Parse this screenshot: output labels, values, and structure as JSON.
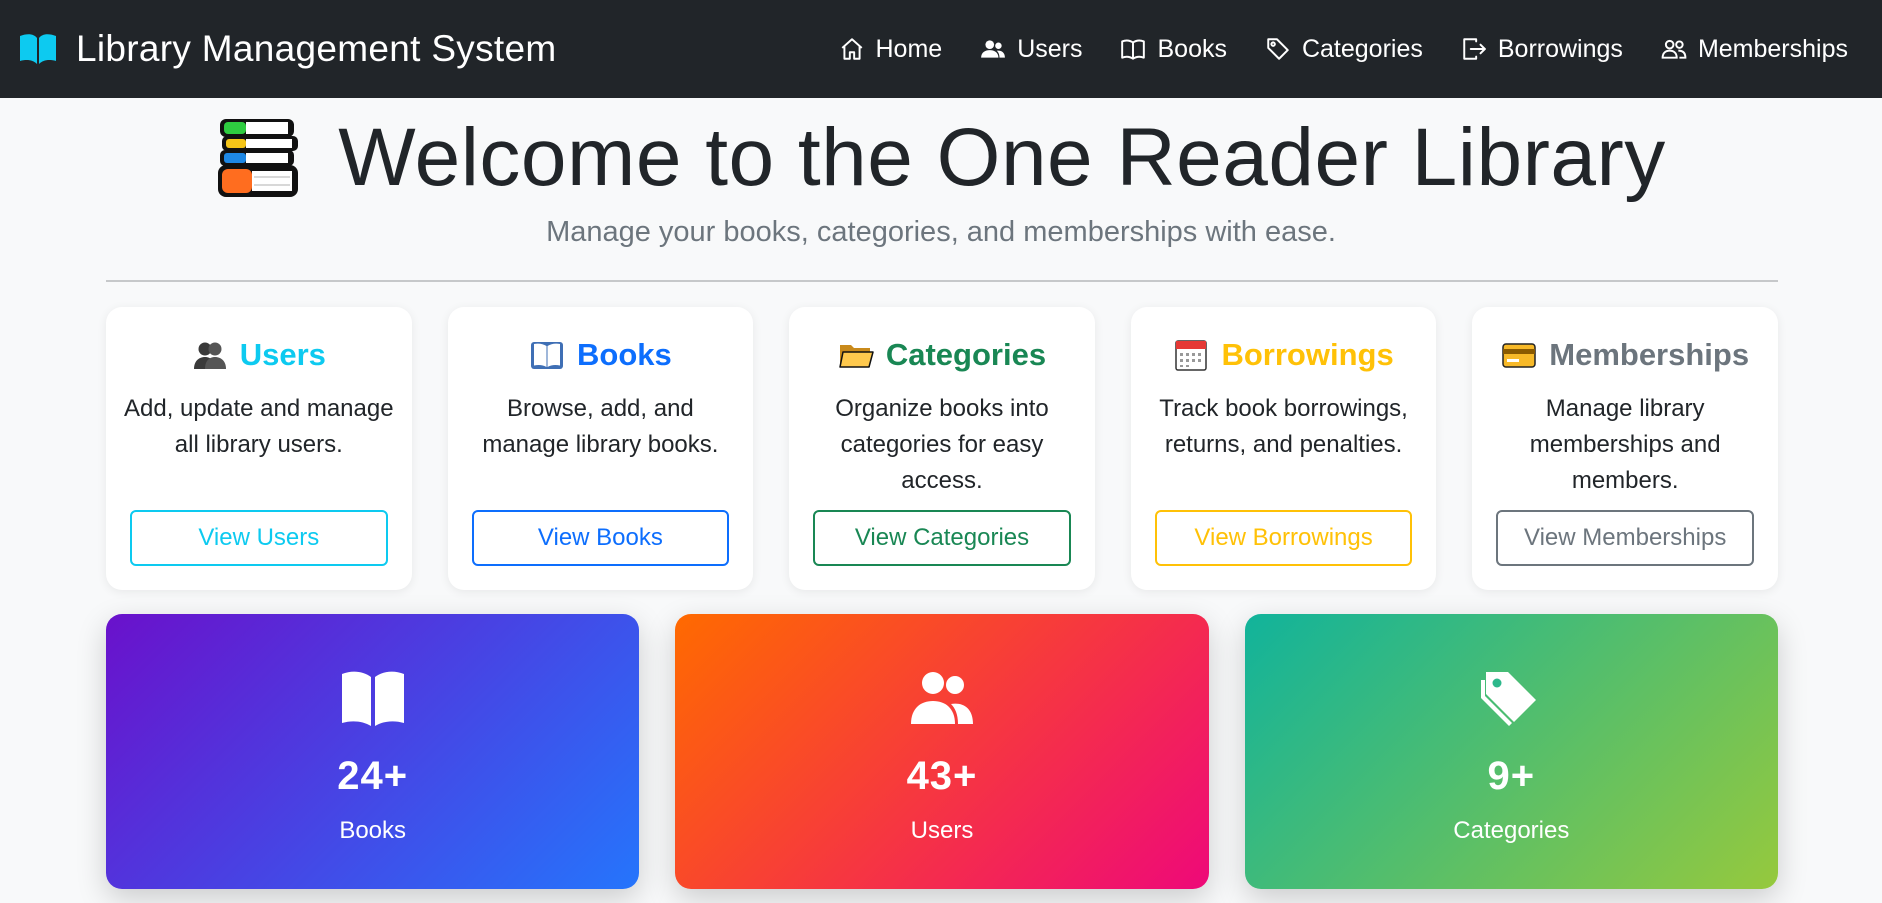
{
  "navbar": {
    "brand": "Library Management System",
    "items": [
      {
        "label": "Home",
        "icon": "house-icon"
      },
      {
        "label": "Users",
        "icon": "users-icon"
      },
      {
        "label": "Books",
        "icon": "book-icon"
      },
      {
        "label": "Categories",
        "icon": "tags-icon"
      },
      {
        "label": "Borrowings",
        "icon": "box-arrow-right-icon"
      },
      {
        "label": "Memberships",
        "icon": "people-icon"
      }
    ]
  },
  "hero": {
    "title": "Welcome to the One Reader Library",
    "subtitle": "Manage your books, categories, and memberships with ease.",
    "icon": "books-stack-icon"
  },
  "cards": [
    {
      "title": "Users",
      "description": "Add, update and manage all library users.",
      "button": "View Users",
      "icon": "users-emoji-icon",
      "color": "#0dcaf0"
    },
    {
      "title": "Books",
      "description": "Browse, add, and manage library books.",
      "button": "View Books",
      "icon": "open-book-emoji-icon",
      "color": "#0d6efd"
    },
    {
      "title": "Categories",
      "description": "Organize books into categories for easy access.",
      "button": "View Categories",
      "icon": "folder-emoji-icon",
      "color": "#198754"
    },
    {
      "title": "Borrowings",
      "description": "Track book borrowings, returns, and penalties.",
      "button": "View Borrowings",
      "icon": "calendar-emoji-icon",
      "color": "#ffc107"
    },
    {
      "title": "Memberships",
      "description": "Manage library memberships and members.",
      "button": "View Memberships",
      "icon": "credit-card-emoji-icon",
      "color": "#6c757d"
    }
  ],
  "stats": [
    {
      "value": "24+",
      "label": "Books",
      "icon": "book-icon"
    },
    {
      "value": "43+",
      "label": "Users",
      "icon": "users-icon"
    },
    {
      "value": "9+",
      "label": "Categories",
      "icon": "tags-icon"
    }
  ]
}
